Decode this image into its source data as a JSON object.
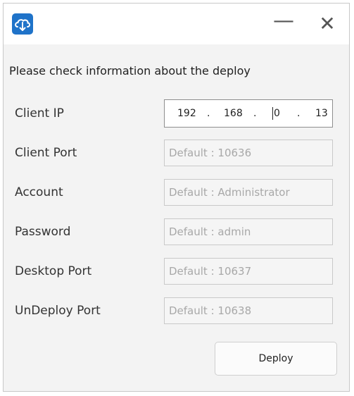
{
  "window": {
    "icon": "cloud-download-icon",
    "minimize_glyph": "—",
    "close_glyph": "✕",
    "accent_color": "#1f73c9"
  },
  "heading": "Please check information about the deploy",
  "fields": {
    "client_ip": {
      "label": "Client IP",
      "octets": [
        "192",
        "168",
        "0",
        "13"
      ]
    },
    "client_port": {
      "label": "Client Port",
      "placeholder": "Default : 10636"
    },
    "account": {
      "label": "Account",
      "placeholder": "Default : Administrator"
    },
    "password": {
      "label": "Password",
      "placeholder": "Default : admin"
    },
    "desktop_port": {
      "label": "Desktop Port",
      "placeholder": "Default : 10637"
    },
    "undeploy_port": {
      "label": "UnDeploy Port",
      "placeholder": "Default : 10638"
    }
  },
  "deploy_button": "Deploy"
}
